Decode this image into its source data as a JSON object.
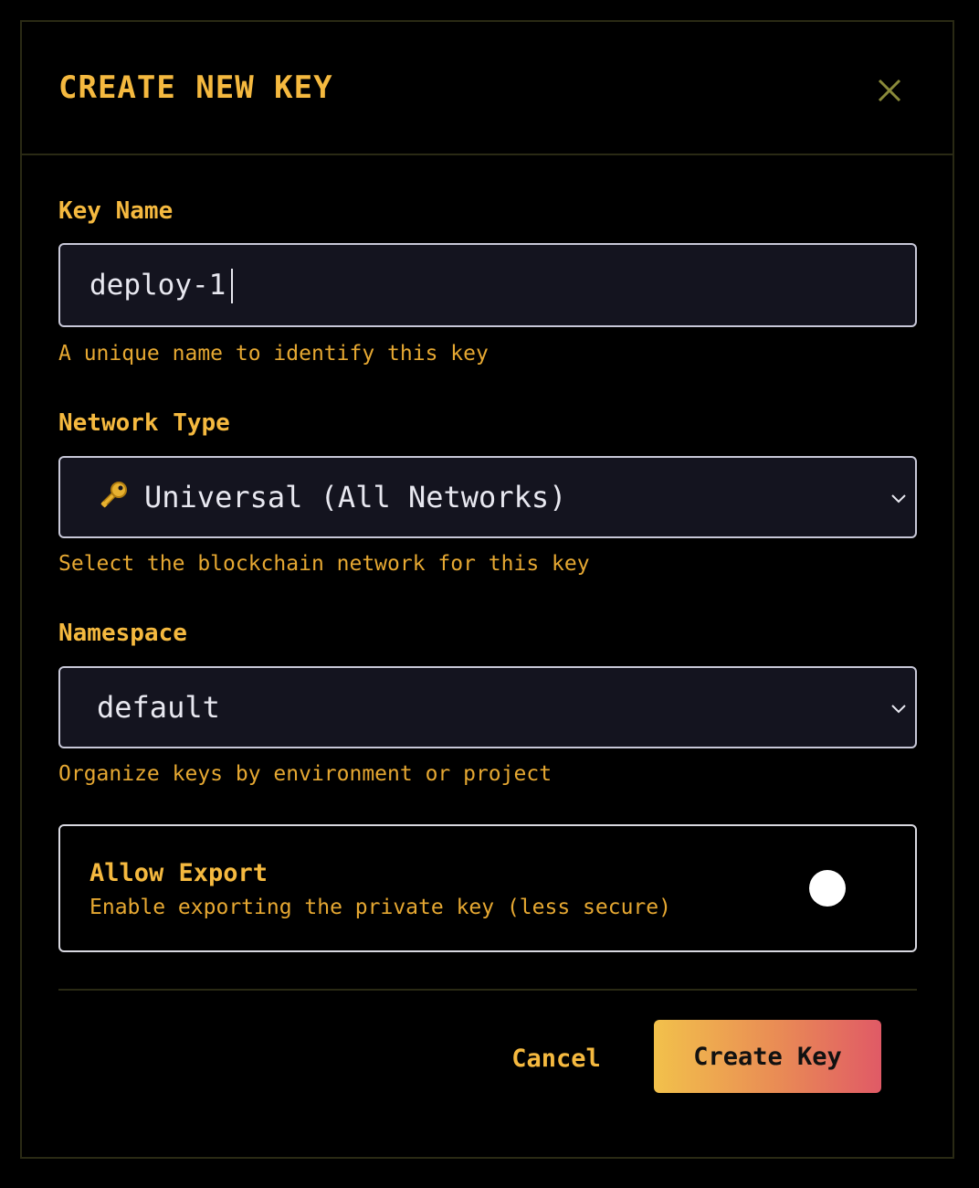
{
  "modal": {
    "title": "CREATE NEW KEY",
    "close_icon": "close-icon"
  },
  "key_name": {
    "label": "Key Name",
    "value": "deploy-1",
    "helper": "A unique name to identify this key"
  },
  "network_type": {
    "label": "Network Type",
    "icon": "key-icon",
    "selected": "Universal (All Networks)",
    "helper": "Select the blockchain network for this key"
  },
  "namespace": {
    "label": "Namespace",
    "selected": "default",
    "helper": "Organize keys by environment or project"
  },
  "allow_export": {
    "title": "Allow Export",
    "description": "Enable exporting the private key (less secure)"
  },
  "footer": {
    "cancel_label": "Cancel",
    "create_label": "Create Key"
  },
  "colors": {
    "accent": "#f5b93f",
    "helper": "#e6a832",
    "field_bg": "#14141f",
    "button_gradient_start": "#f2c14b",
    "button_gradient_end": "#e05a66"
  }
}
